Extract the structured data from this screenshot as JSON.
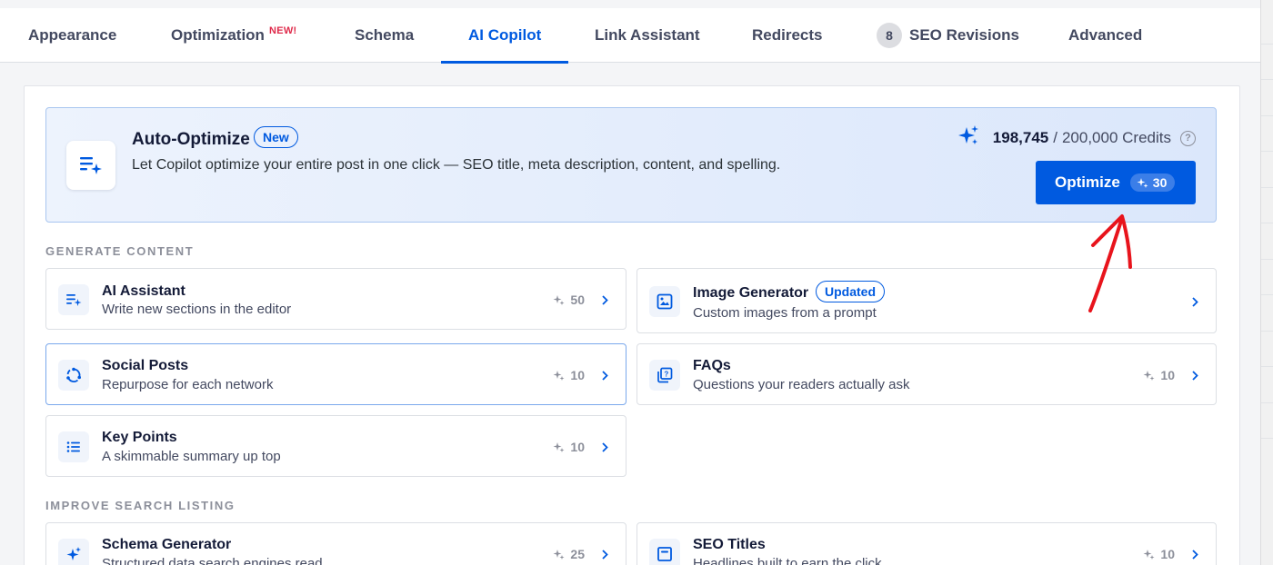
{
  "tabs": [
    {
      "label": "Appearance"
    },
    {
      "label": "Optimization",
      "tag": "NEW!"
    },
    {
      "label": "Schema"
    },
    {
      "label": "AI Copilot",
      "active": true
    },
    {
      "label": "Link Assistant"
    },
    {
      "label": "Redirects"
    },
    {
      "label": "SEO Revisions",
      "count": "8"
    },
    {
      "label": "Advanced"
    }
  ],
  "auto_optimize": {
    "icon": "list-sparkle-icon",
    "title": "Auto-Optimize",
    "badge": "New",
    "description": "Let Copilot optimize your entire post in one click — SEO title, meta description, content, and spelling.",
    "credits_used": "198,745",
    "credits_separator": "/",
    "credits_total": "200,000 Credits",
    "help": "?",
    "button_label": "Optimize",
    "button_cost": "30"
  },
  "generate_content": {
    "label": "GENERATE CONTENT",
    "cards": [
      {
        "title": "AI Assistant",
        "description": "Write new sections in the editor",
        "cost": "50",
        "icon": "list-sparkle-icon"
      },
      {
        "title": "Image Generator",
        "badge": "Updated",
        "description": "Custom images from a prompt",
        "icon": "image-icon"
      },
      {
        "title": "Social Posts",
        "description": "Repurpose for each network",
        "cost": "10",
        "icon": "share-cycle-icon"
      },
      {
        "title": "FAQs",
        "description": "Questions your readers actually ask",
        "cost": "10",
        "icon": "question-cards-icon"
      },
      {
        "title": "Key Points",
        "description": "A skimmable summary up top",
        "cost": "10",
        "icon": "bullet-list-icon"
      }
    ]
  },
  "improve_search": {
    "label": "IMPROVE SEARCH LISTING",
    "cards": [
      {
        "title": "Schema Generator",
        "description": "Structured data search engines read",
        "cost": "25",
        "icon": "sparkles-icon"
      },
      {
        "title": "SEO Titles",
        "description": "Headlines built to earn the click",
        "cost": "10",
        "icon": "title-box-icon"
      }
    ]
  },
  "colors": {
    "accent": "#005ae0",
    "new_tag": "#df2a4a",
    "annotation": "#e8141c"
  }
}
